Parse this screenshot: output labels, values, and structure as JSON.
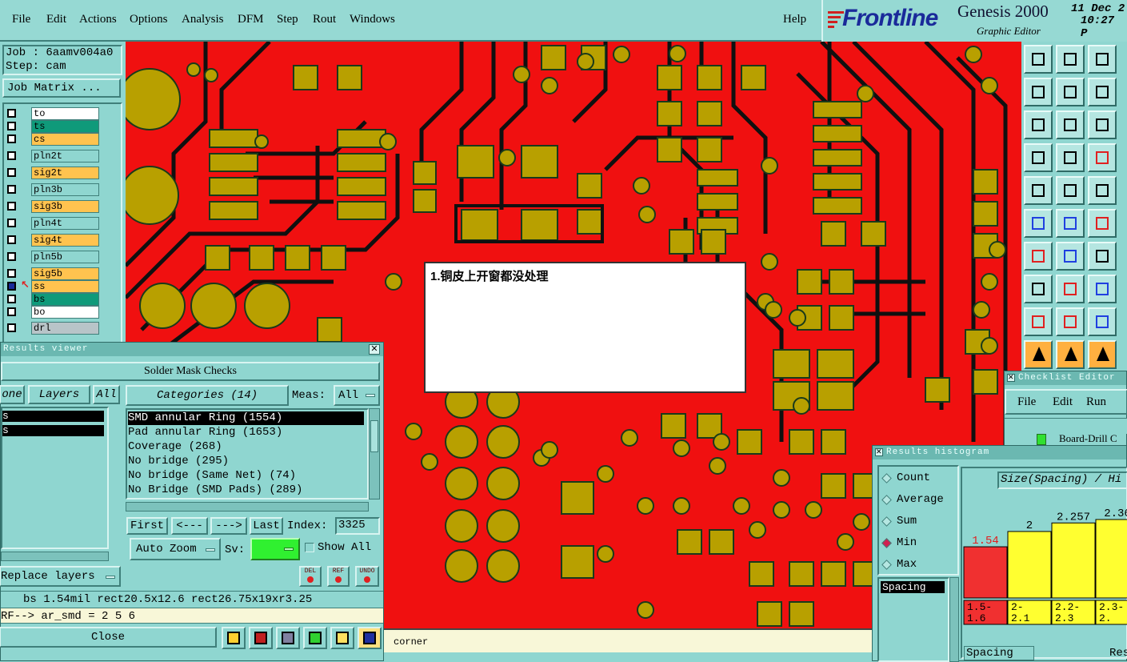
{
  "menubar": {
    "items": [
      "File",
      "Edit",
      "Actions",
      "Options",
      "Analysis",
      "DFM",
      "Step",
      "Rout",
      "Windows"
    ],
    "help": "Help"
  },
  "brand": {
    "logo_text": "Frontline",
    "product": "Genesis 2000",
    "subtitle": "Graphic Editor",
    "date": "11 Dec 2",
    "time": "10:27 P"
  },
  "job": {
    "job_label": "Job : 6aamv004a0",
    "step_label": "Step: cam",
    "matrix_button": "Job Matrix ..."
  },
  "layers": [
    {
      "name": "to",
      "color": "#ffffff"
    },
    {
      "name": "ts",
      "color": "#0f9a7a"
    },
    {
      "name": "cs",
      "color": "#ffc34f"
    },
    {
      "name": "pln2t",
      "color": "#8fd6d0"
    },
    {
      "name": "sig2t",
      "color": "#ffc34f"
    },
    {
      "name": "pln3b",
      "color": "#8fd6d0"
    },
    {
      "name": "sig3b",
      "color": "#ffc34f"
    },
    {
      "name": "pln4t",
      "color": "#8fd6d0"
    },
    {
      "name": "sig4t",
      "color": "#ffc34f"
    },
    {
      "name": "pln5b",
      "color": "#8fd6d0"
    },
    {
      "name": "sig5b",
      "color": "#ffc34f"
    },
    {
      "name": "ss",
      "color": "#ffc34f"
    },
    {
      "name": "bs",
      "color": "#0f9a7a"
    },
    {
      "name": "bo",
      "color": "#ffffff"
    },
    {
      "name": "drl",
      "color": "#b8c4c8"
    }
  ],
  "dialog": {
    "message": "1.铜皮上开窗都没处理"
  },
  "results_viewer": {
    "title": "Results viewer",
    "header": "Solder Mask Checks",
    "tab_none": "one",
    "tab_layers": "Layers",
    "tab_all": "All",
    "categories_button": "Categories (14)",
    "meas_label": "Meas:",
    "meas_value": "All",
    "left_rows": [
      "s",
      "s"
    ],
    "categories": [
      "SMD annular Ring (1554)",
      "Pad annular Ring (1653)",
      "Coverage (268)",
      "No bridge (295)",
      "No bridge (Same Net) (74)",
      "No Bridge (SMD Pads) (289)"
    ],
    "nav": {
      "first": "First",
      "prev": "<---",
      "next": "--->",
      "last": "Last",
      "index_label": "Index:",
      "index_value": "3325"
    },
    "auto_zoom": "Auto Zoom",
    "sv_label": "Sv:",
    "show_all": "Show All",
    "replace_layers": "Replace layers",
    "small_buttons": [
      "DEL",
      "REF",
      "UNDO"
    ],
    "info_line": "bs 1.54mil  rect20.5x12.6  rect26.75x19xr3.25",
    "ref_line": "RF--> ar_smd = 2 5 6",
    "close": "Close"
  },
  "status": {
    "text": "corner"
  },
  "checklist": {
    "title": "Checklist Editor",
    "menu": [
      "File",
      "Edit",
      "Run"
    ],
    "row": "Board-Drill C"
  },
  "histogram": {
    "title": "Results histogram",
    "options": [
      "Count",
      "Average",
      "Sum",
      "Min",
      "Max"
    ],
    "selected": "Min",
    "measure": "Spacing",
    "header": "Size(Spacing) / Hi",
    "footer_left": "Spacing",
    "footer_right": "Res",
    "bars": [
      {
        "value": "1.54",
        "range": "1.5-\n1.6",
        "color": "#f03030"
      },
      {
        "value": "2",
        "range": "2-\n2.1",
        "color": "#ffff30"
      },
      {
        "value": "2.257",
        "range": "2.2-\n2.3",
        "color": "#ffff30"
      },
      {
        "value": "2.36",
        "range": "2.3-\n2.",
        "color": "#ffff30"
      }
    ]
  },
  "colors": {
    "board": "#f01010",
    "pad": "#b8a000",
    "trace": "#101010",
    "ui_bg": "#8fd6d0"
  }
}
